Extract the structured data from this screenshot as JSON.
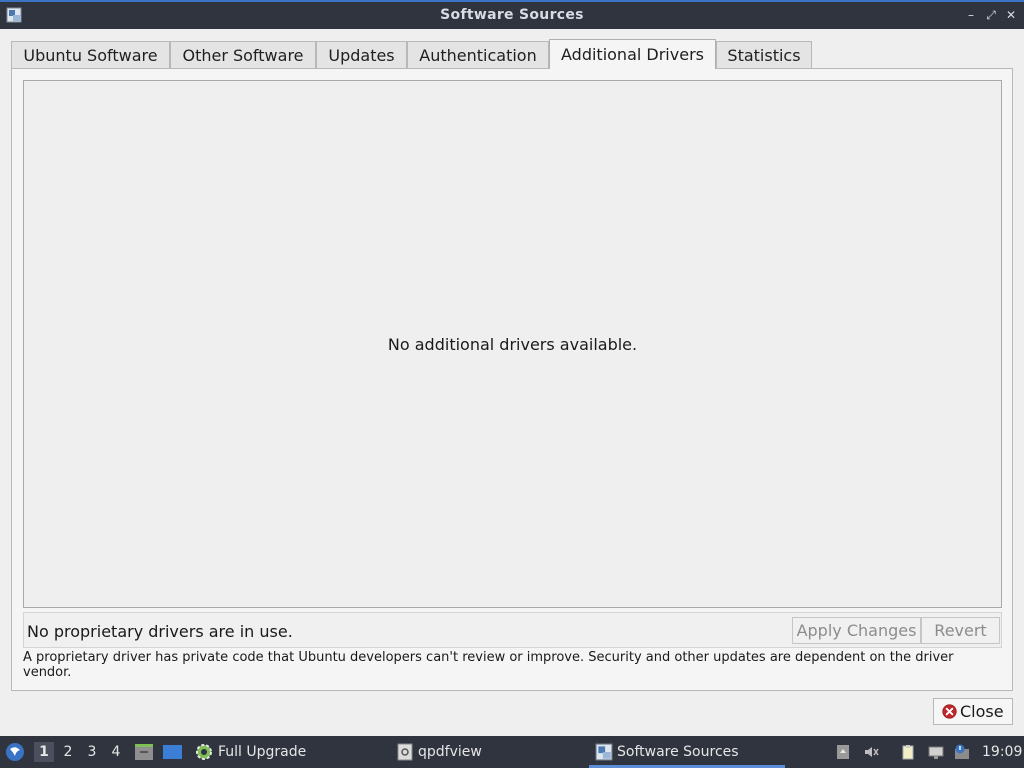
{
  "window": {
    "title": "Software Sources",
    "minimize": "–",
    "maximize": "⤢",
    "close": "✕"
  },
  "tabs": [
    {
      "label": "Ubuntu Software"
    },
    {
      "label": "Other Software"
    },
    {
      "label": "Updates"
    },
    {
      "label": "Authentication"
    },
    {
      "label": "Additional Drivers",
      "active": true
    },
    {
      "label": "Statistics"
    }
  ],
  "drivers": {
    "empty_message": "No additional drivers available.",
    "status_text": "No proprietary drivers are in use.",
    "apply_label": "Apply Changes",
    "revert_label": "Revert",
    "note": "A proprietary driver has private code that Ubuntu developers can't review or improve. Security and other updates are dependent on the driver vendor."
  },
  "dialog": {
    "close_label": "Close"
  },
  "taskbar": {
    "workspaces": [
      "1",
      "2",
      "3",
      "4"
    ],
    "active_workspace": "1",
    "tasks": [
      {
        "label": "Full Upgrade",
        "icon": "gear-icon"
      },
      {
        "label": "qpdfview",
        "icon": "document-icon"
      },
      {
        "label": "Software Sources",
        "icon": "software-sources-icon",
        "active": true
      }
    ],
    "clock": "19:09"
  },
  "colors": {
    "titlebar_bg": "#2f343f",
    "accent": "#3b73c4",
    "close_icon_red": "#c0262c"
  }
}
